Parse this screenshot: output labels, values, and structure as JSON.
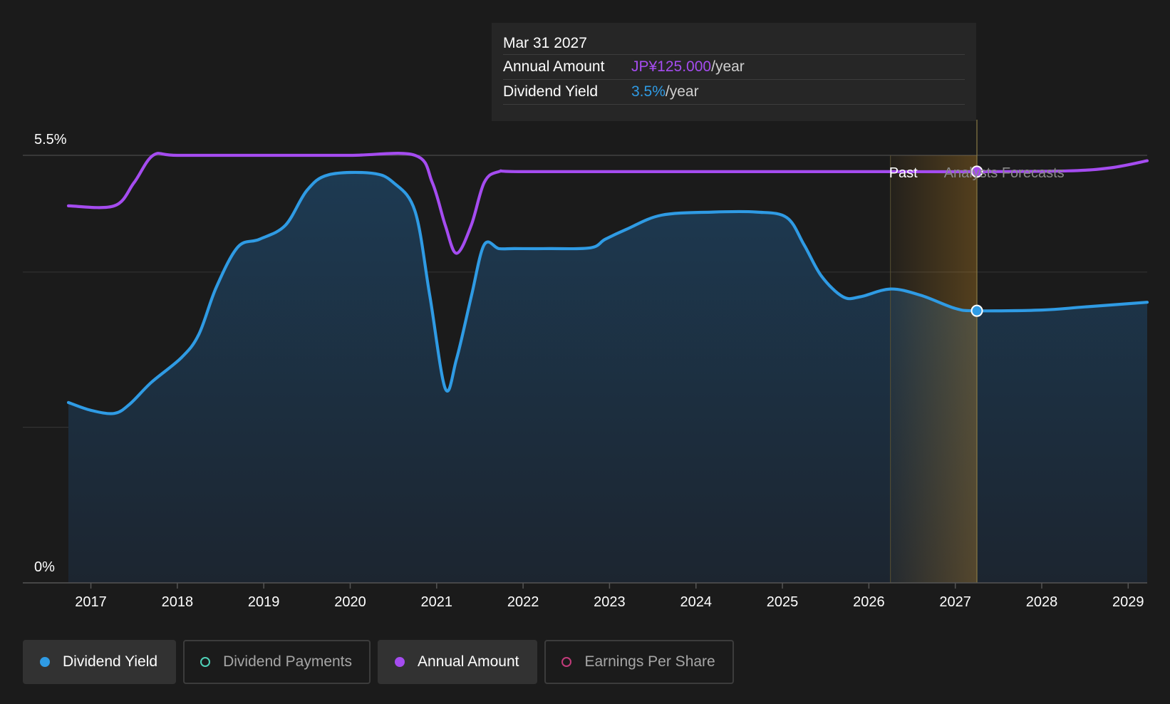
{
  "colors": {
    "yield": "#2f9be4",
    "annual": "#a54cf0",
    "payments": "#4fd1b8",
    "eps": "#c23b7a",
    "forecast_band": "#f5a623"
  },
  "tooltip": {
    "date": "Mar 31 2027",
    "rows": [
      {
        "label": "Annual Amount",
        "value": "JP¥125.000",
        "unit": "/year"
      },
      {
        "label": "Dividend Yield",
        "value": "3.5%",
        "unit": "/year"
      }
    ]
  },
  "legend": [
    {
      "label": "Dividend Yield",
      "active": true,
      "style": "filled",
      "color": "#2f9be4"
    },
    {
      "label": "Dividend Payments",
      "active": false,
      "style": "outline",
      "color": "#4fd1b8"
    },
    {
      "label": "Annual Amount",
      "active": true,
      "style": "filled",
      "color": "#a54cf0"
    },
    {
      "label": "Earnings Per Share",
      "active": false,
      "style": "outline",
      "color": "#c23b7a"
    }
  ],
  "chart_data": {
    "type": "area",
    "xlim": [
      2016.74,
      2029.22
    ],
    "ylim": [
      0,
      5.5
    ],
    "ytick_labels": [
      "5.5%",
      "0%"
    ],
    "x_ticks": [
      2017,
      2018,
      2019,
      2020,
      2021,
      2022,
      2023,
      2024,
      2025,
      2026,
      2027,
      2028,
      2029
    ],
    "grid": true,
    "past_label": "Past",
    "forecast_label": "Analysts Forecasts",
    "past_end": 2026.25,
    "forecast_band": [
      2026.25,
      2027.25
    ],
    "highlight_x": 2027.25,
    "series": [
      {
        "name": "Dividend Yield",
        "color": "#2f9be4",
        "fill": true,
        "x": [
          2016.74,
          2017.0,
          2017.27,
          2017.45,
          2017.7,
          2018.05,
          2018.25,
          2018.45,
          2018.7,
          2018.95,
          2019.25,
          2019.5,
          2019.75,
          2020.25,
          2020.5,
          2020.75,
          2020.92,
          2021.1,
          2021.23,
          2021.4,
          2021.55,
          2021.72,
          2021.9,
          2022.3,
          2022.78,
          2022.95,
          2023.2,
          2023.6,
          2024.2,
          2024.7,
          2025.05,
          2025.25,
          2025.45,
          2025.7,
          2025.9,
          2026.25,
          2026.6,
          2027.0,
          2027.25,
          2028.0,
          2028.5,
          2029.22
        ],
        "y": [
          2.32,
          2.22,
          2.18,
          2.3,
          2.58,
          2.9,
          3.2,
          3.8,
          4.32,
          4.42,
          4.6,
          5.05,
          5.25,
          5.27,
          5.15,
          4.78,
          3.7,
          2.5,
          2.88,
          3.68,
          4.35,
          4.3,
          4.3,
          4.3,
          4.31,
          4.42,
          4.55,
          4.73,
          4.77,
          4.77,
          4.7,
          4.35,
          3.95,
          3.68,
          3.68,
          3.78,
          3.7,
          3.53,
          3.5,
          3.51,
          3.55,
          3.61
        ]
      },
      {
        "name": "Annual Amount",
        "color": "#a54cf0",
        "fill": false,
        "x": [
          2016.74,
          2017.27,
          2017.5,
          2017.72,
          2018.0,
          2019.0,
          2020.0,
          2020.75,
          2020.95,
          2021.1,
          2021.23,
          2021.4,
          2021.55,
          2021.72,
          2022.0,
          2024.0,
          2026.25,
          2027.25,
          2028.3,
          2028.8,
          2029.22
        ],
        "y": [
          4.85,
          4.85,
          5.15,
          5.5,
          5.5,
          5.5,
          5.5,
          5.5,
          5.15,
          4.6,
          4.24,
          4.6,
          5.15,
          5.29,
          5.29,
          5.29,
          5.29,
          5.29,
          5.3,
          5.34,
          5.43
        ]
      }
    ]
  }
}
